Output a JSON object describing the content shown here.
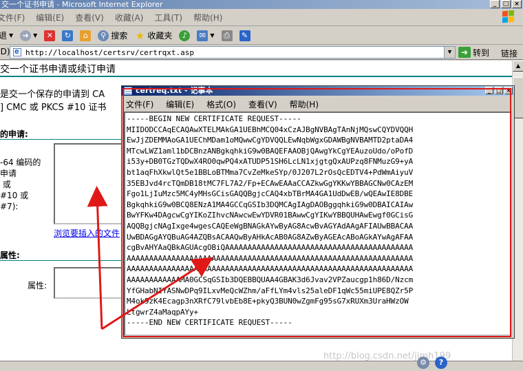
{
  "ie": {
    "title": "交一个证书申请 - Microsoft Internet Explorer",
    "menu": [
      "文件(F)",
      "编辑(E)",
      "查看(V)",
      "收藏(A)",
      "工具(T)",
      "帮助(H)"
    ],
    "toolbar": {
      "back": "退",
      "search": "搜索",
      "favorites": "收藏夹"
    },
    "address": {
      "label": "(D)",
      "url": "http://localhost/certsrv/certrqxt.asp",
      "go": "转到",
      "links": "链接"
    },
    "status_watermark": "http://blog.csdn.net/jimh199"
  },
  "page": {
    "heading": "交一个证书申请或续订申请",
    "intro_line1": "是交一个保存的申请到 CA",
    "intro_line2": "] CMC 或 PKCS #10 证书",
    "saved_section": "的申请:",
    "encoding_label": "-64 编码的\n申请\n 或\n#10 或\n#7):",
    "browse_link": "浏览要插入的文件",
    "attributes_section": "属性:",
    "attributes_label": "属性:"
  },
  "notepad": {
    "title": "certreq.txt - 记事本",
    "menu": [
      "文件(F)",
      "编辑(E)",
      "格式(O)",
      "查看(V)",
      "帮助(H)"
    ],
    "content": "-----BEGIN NEW CERTIFICATE REQUEST-----\nMIIDODCCAqECAQAwXTELMAkGA1UEBhMCQ04xCzAJBgNVBAgTAnNjMQswCQYDVQQH\nEwJjZDEMMAoGA1UEChMDam1oMQwwCgYDVQQLEwNqbWgxGDAWBgNVBAMTD2ptaDA4\nMTcwLWZ1aml1bDCBnzANBgkqhkiG9w0BAQEFAAOBjQAwgYkCgYEAuzoUdo/oPofD\ni53y+DB0TGzTQDwX4RO0qwPQ4xATUDP51SH6LcLN1xjgtgQxAUPzq8FNMuzG9+yA\nbt1aqFhXkwlQt5e1BBLoBTMma7CvZeMkeSYp/0J207L2rOsQcEDTV4+PdWmAiyuV\n35EBJvd4rcTQmDB18tMC7FL7A2/Fp+ECAwEAAaCCAZkwGgYKKwYBBAGCNw0CAzEM\nFgo1LjIuMzc5MC4yMHsGCisGAQQBgjcCAQ4xbTBrMA4GA1UdDwEB/wQEAwIE8DBE\nBgkqhkiG9w0BCQ8ENzA1MA4GCCqGSIb3DQMCAgIAgDAOBggqhkiG9w0DBAICAIAw\nBwYFKw4DAgcwCgYIKoZIhvcNAwcwEwYDVR01BAwwCgYIKwYBBQUHAwEwgf0GCisG\nAQQBgjcNAgIxge4wgesCAQEeWgBNAGkAYwByAG8AcwBvAGYAdAAgAFIAUwBBACAA\nUwBDAGgAYQBuAG4AZQBsACAAQwByAHkAcAB0AG8AZwByAGEAcABoAGkAYwAgAFAA\ncgBvAHYAaQBkAGUAcgOBiQAAAAAAAAAAAAAAAAAAAAAAAAAAAAAAAAAAAAAAAAAA\nAAAAAAAAAAAAAAAAAAAAAAAAAAAAAAAAAAAAAAAAAAAAAAAAAAAAAAAAAAAAAAAA\nAAAAAAAAAAAAAAAAAAAAAAAAAAAAAAAAAAAAAAAAAAAAAAAAAAAAAAAAAAAAAAAA\nAAAAAAAAAAAAMA0GCSqGSIb3DQEBBQUAA4GBAK3d6Jvav2VPZaucgp1h86D/Nzcm\nYfGHabNIYASNwDPq9ILxvMeQcWZhm/aFfLYm4vls25aleDF1qWc55miUPE8QZr5P\nM4ok9zK4Ecagp3nXRfC79lvbEb8E+pkyQ3BUN0wZgmFg95sG7xRUXm3UraHWzOW\nLtgwrZ4aMaqpAYy+\n-----END NEW CERTIFICATE REQUEST-----"
  },
  "colors": {
    "annotation": "#e01818",
    "notepad_titlebar": "#0a246a",
    "ie_titlebar": "#5f7fae",
    "link": "#0000ee",
    "section_rule": "#008080"
  }
}
